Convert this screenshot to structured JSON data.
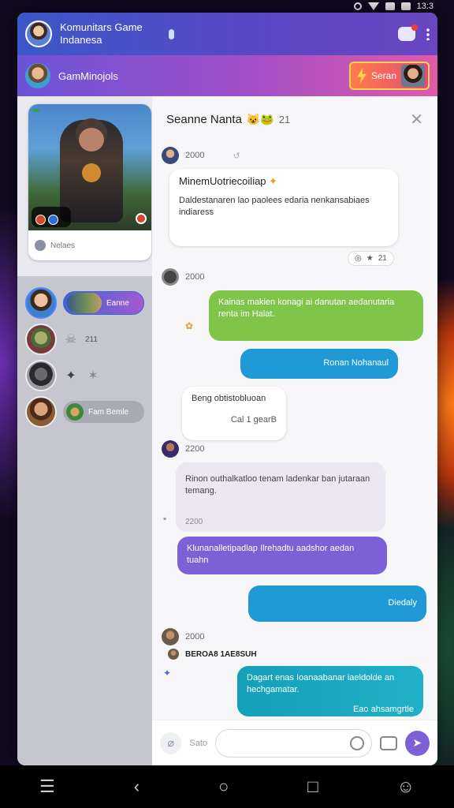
{
  "status": {
    "time": "13:3"
  },
  "header": {
    "title": "Komunitars Game Indanesa"
  },
  "subbar": {
    "name": "GamMinojols",
    "join_label": "Seran"
  },
  "sidebar": {
    "game_badge": "",
    "card_label": "Nelaes",
    "active_user_label": "Eanne",
    "user2_count": "211",
    "user4_label": "Fam Bemle"
  },
  "chat": {
    "title": "Seanne Nanta",
    "title_emoji": "😺🐸",
    "count": "21",
    "messages": [
      {
        "time": "2000"
      },
      {
        "title": "MinemUotriecoiliap",
        "text": "Daldestanaren lao paolees edaria nenkansabiaes indiaress",
        "reaction": "21"
      },
      {
        "time": "2000"
      },
      {
        "text": "Kainas makien konagi ai danutan aedanutaria renta im Halat."
      },
      {
        "text": "Ronan Nohanaul"
      },
      {
        "text": "Beng obtistobluoan",
        "sub": "Cal 1 gearB"
      },
      {
        "time": "2200"
      },
      {
        "text": "Rinon outhalkatloo tenam ladenkar ban jutaraan temang.",
        "time": "2200"
      },
      {
        "text": "Klunanalletipadlap Ilrehadtu aadshor aedan tuahn"
      },
      {
        "text": "Diedaly"
      },
      {
        "time": "2000",
        "name": "BEROA8 1AE8SUH"
      },
      {
        "text": "Dagart enas  Ioanaabanar iaeldolde an hechgamatar.",
        "sub": "Eao ahsamgrtle"
      }
    ]
  },
  "composer": {
    "label": "Sato",
    "placeholder": ""
  },
  "nav": {
    "menu": "☰",
    "back": "‹",
    "home": "○",
    "recents": "□",
    "assist": "☺"
  }
}
